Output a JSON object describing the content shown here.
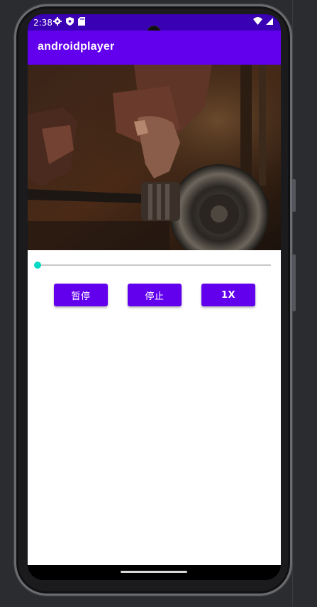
{
  "status_bar": {
    "time": "2:38",
    "left_icons": [
      "gear-icon",
      "shield-icon",
      "sd-card-icon"
    ],
    "right_icons": [
      "wifi-icon",
      "signal-icon"
    ]
  },
  "app_bar": {
    "title": "androidplayer",
    "color": "#6200ee"
  },
  "player": {
    "progress": 0,
    "seekbar_thumb_color": "#03dac5"
  },
  "controls": {
    "pause_label": "暂停",
    "stop_label": "停止",
    "speed_label": "1X"
  },
  "colors": {
    "status_bar": "#3a00b3",
    "primary": "#6200ee",
    "accent": "#03dac5"
  }
}
